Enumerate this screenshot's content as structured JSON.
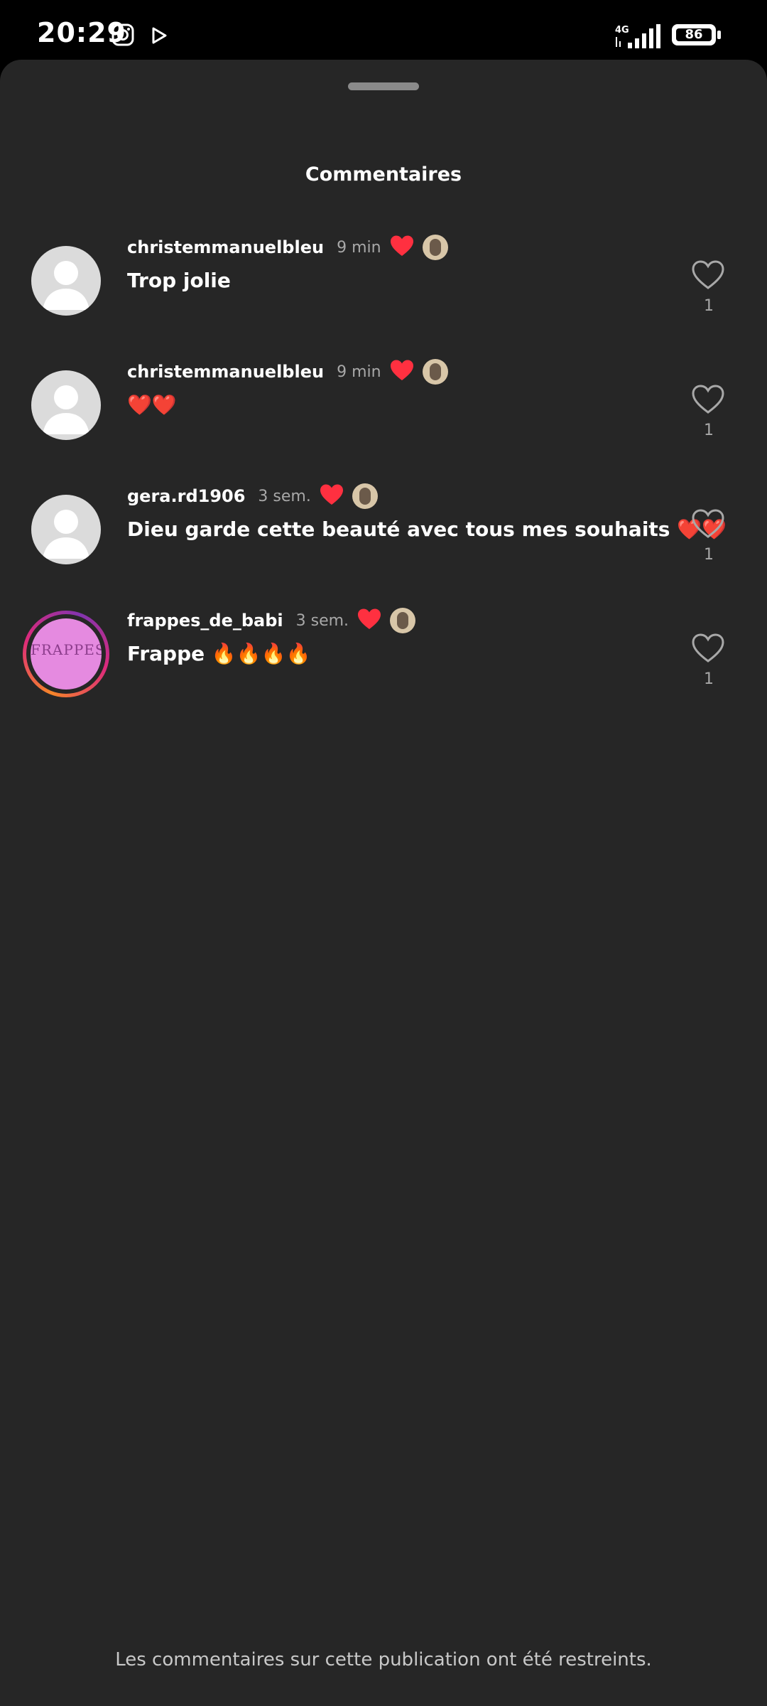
{
  "status_bar": {
    "time": "20:29",
    "network": "4G",
    "battery": "86",
    "icons": [
      "instagram-icon",
      "play-store-icon",
      "signal-icon",
      "battery-icon"
    ]
  },
  "sheet": {
    "title": "Commentaires"
  },
  "comments": [
    {
      "username": "christemmanuelbleu",
      "time": "9 min",
      "text": "Trop jolie",
      "likes": "1",
      "liked_by_author": true,
      "avatar": "default-avatar"
    },
    {
      "username": "christemmanuelbleu",
      "time": "9 min",
      "text": "❤️❤️",
      "likes": "1",
      "liked_by_author": true,
      "avatar": "default-avatar"
    },
    {
      "username": "gera.rd1906",
      "time": "3 sem.",
      "text": "Dieu garde cette beauté avec tous mes souhaits ❤️❤️",
      "likes": "1",
      "liked_by_author": true,
      "avatar": "default-avatar"
    },
    {
      "username": "frappes_de_babi",
      "time": "3 sem.",
      "text": "Frappe 🔥🔥🔥🔥",
      "likes": "1",
      "liked_by_author": true,
      "avatar": "story-avatar",
      "avatar_text": "FRAPPES."
    }
  ],
  "footer": {
    "note": "Les commentaires sur cette publication ont été restreints."
  },
  "colors": {
    "background": "#262626",
    "status_bar": "#000000",
    "heart_red": "#ff3040",
    "secondary_text": "#a8a8a8"
  }
}
